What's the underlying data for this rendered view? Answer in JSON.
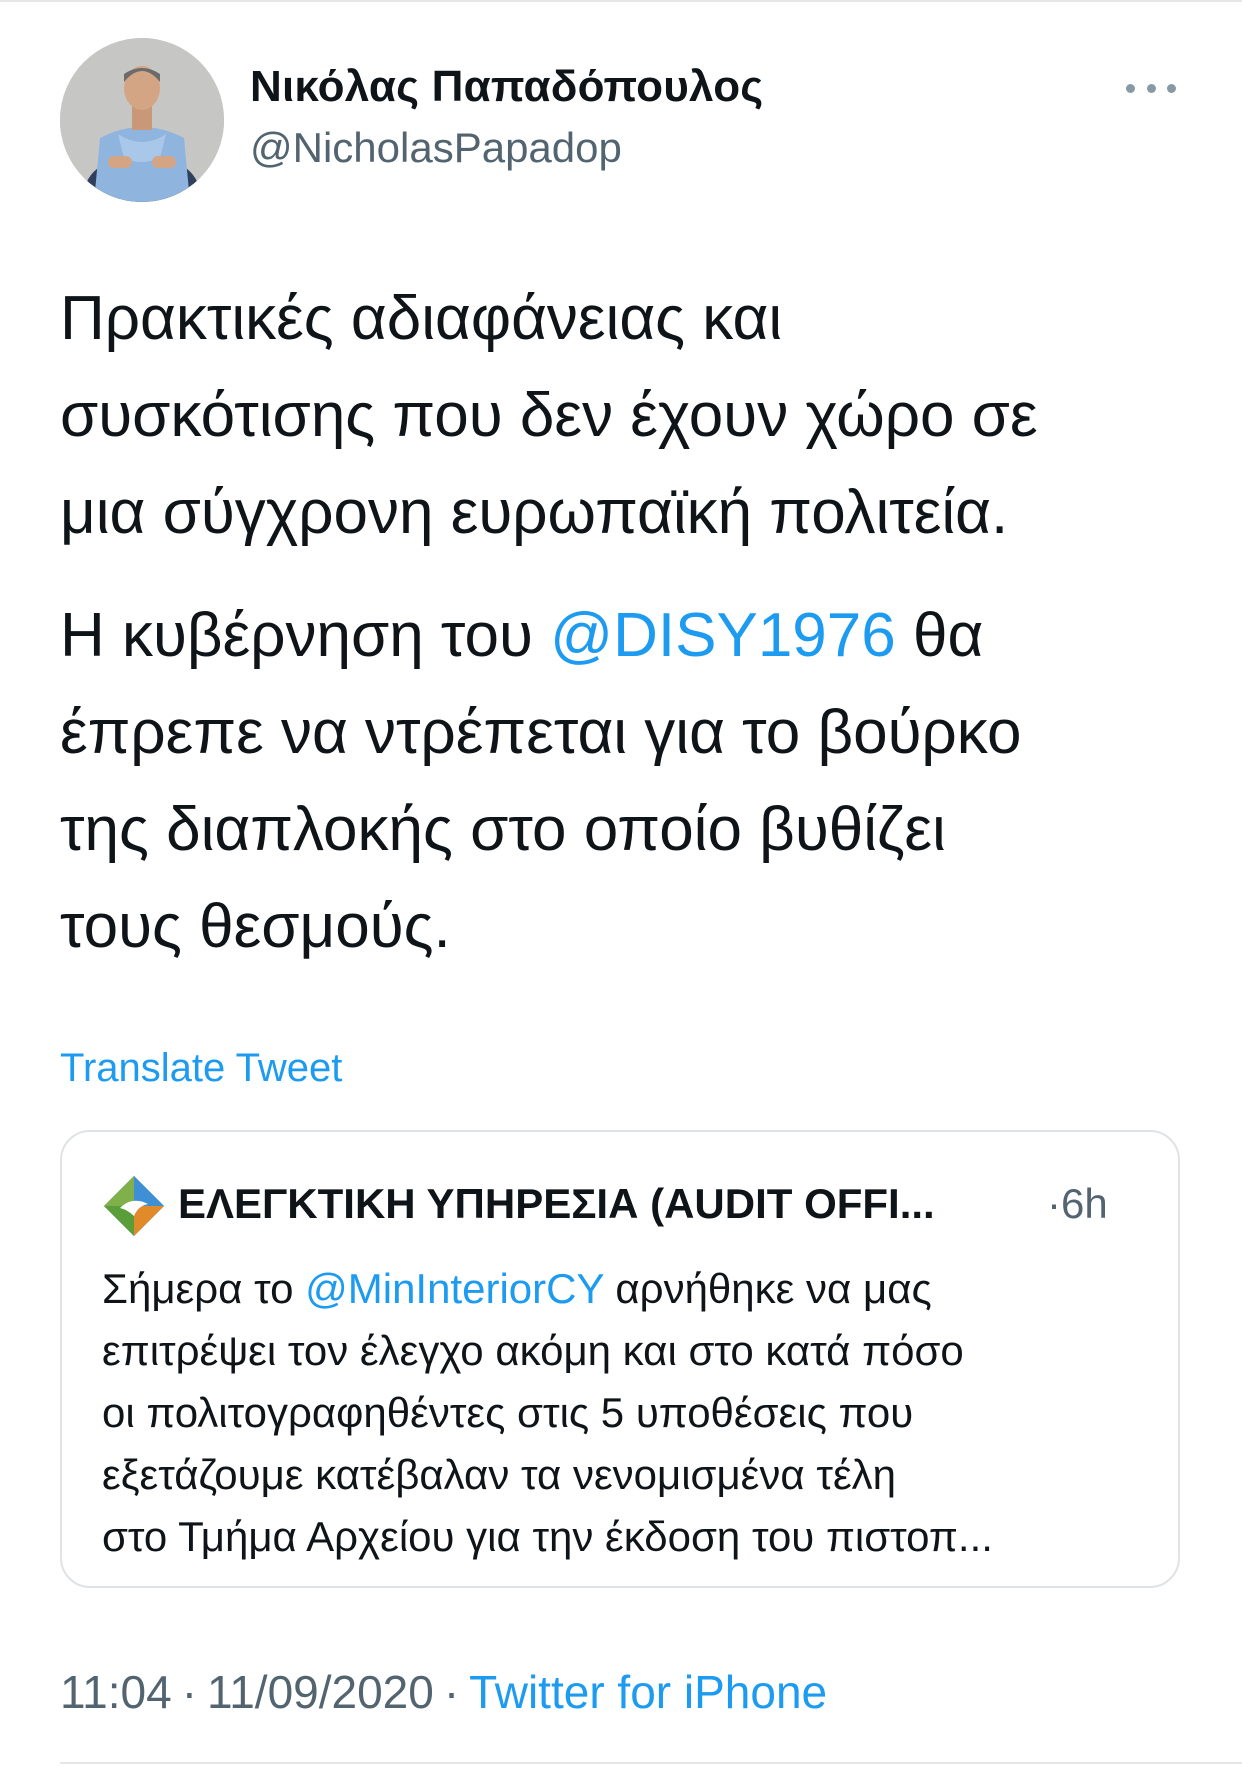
{
  "author": {
    "display_name": "Νικόλας Παπαδόπουλος",
    "handle": "@NicholasPapadop",
    "avatar_icon": "profile-photo"
  },
  "more_icon": "ellipsis-icon",
  "tweet": {
    "paragraph1": {
      "line1": "Πρακτικές αδιαφάνειας και",
      "line2": "συσκότισης που δεν έχουν χώρο σε",
      "line3": "μια σύγχρονη ευρωπαϊκή πολιτεία."
    },
    "paragraph2": {
      "line1_before": "Η κυβέρνηση του ",
      "mention": "@DISY1976",
      "line1_after": " θα",
      "line2": "έπρεπε να ντρέπεται για το βούρκο",
      "line3": "της διαπλοκής στο οποίο βυθίζει",
      "line4": "τους θεσμούς."
    }
  },
  "translate_label": "Translate Tweet",
  "quoted": {
    "logo_icon": "audit-office-logo-icon",
    "name": "ΕΛΕΓΚΤΙΚΗ ΥΠΗΡΕΣΙΑ (AUDIT OFFI...",
    "time": "·6h",
    "line1_before": "Σήμερα το ",
    "line1_mention": "@MinInteriorCY",
    "line1_after": " αρνήθηκε να μας",
    "line2": "επιτρέψει τον έλεγχο ακόμη και στο κατά πόσο",
    "line3": "οι πολιτογραφηθέντες στις 5 υποθέσεις που",
    "line4": "εξετάζουμε κατέβαλαν τα νενομισμένα τέλη",
    "line5": "στο Τμήμα Αρχείου για την έκδοση του πιστοπ..."
  },
  "meta": {
    "time": "11:04",
    "separator": "·",
    "date": "11/09/2020",
    "source": "Twitter for iPhone"
  },
  "colors": {
    "link": "#1d9bf0",
    "secondary_text": "#536471",
    "border": "#dfe3e6"
  }
}
